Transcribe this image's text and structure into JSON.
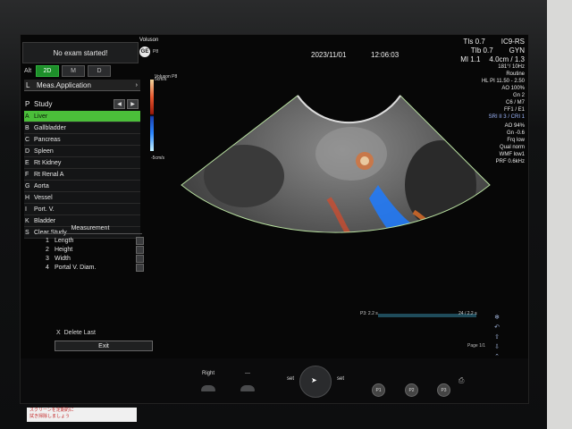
{
  "header": {
    "brand": "Voluson",
    "brand_sub": "P8",
    "date": "2023/11/01",
    "time": "12:06:03",
    "tis": "TIs  0.7",
    "tib": "TIb  0.7",
    "mi": "MI  1.1",
    "probe": "IC9-RS",
    "app": "GYN",
    "depth": "4.0cm / 1.3"
  },
  "left_panel": {
    "status": "No exam started!",
    "mode_label": "Alt",
    "modes": [
      "2D",
      "M",
      "D"
    ],
    "meas_key": "L",
    "meas_app": "Meas.Application",
    "study_key": "P",
    "study_label": "Study",
    "study_items": [
      {
        "key": "A",
        "label": "Liver"
      },
      {
        "key": "B",
        "label": "Gallbladder"
      },
      {
        "key": "C",
        "label": "Pancreas"
      },
      {
        "key": "D",
        "label": "Spleen"
      },
      {
        "key": "E",
        "label": "Rt Kidney"
      },
      {
        "key": "F",
        "label": "Rt Renal A"
      },
      {
        "key": "G",
        "label": "Aorta"
      },
      {
        "key": "H",
        "label": "Vessel"
      },
      {
        "key": "I",
        "label": "Port. V."
      },
      {
        "key": "K",
        "label": "Bladder"
      },
      {
        "key": "S",
        "label": "Clear Study"
      }
    ],
    "measurement_header": "Measurement",
    "measurements": [
      {
        "key": "1",
        "label": "Length"
      },
      {
        "key": "2",
        "label": "Height"
      },
      {
        "key": "3",
        "label": "Width"
      },
      {
        "key": "4",
        "label": "Portal V. Diam."
      }
    ],
    "delete_key": "X",
    "delete_label": "Delete Last",
    "exit_label": "Exit"
  },
  "image_params": {
    "frame": "181°/ 10Hz",
    "routine": "Routine",
    "hl": "HL PI 11.50 - 2.50",
    "ao": "AO 100%",
    "gn": "Gn  2",
    "c6": "C6 / M7",
    "ff": "FF1 / E1",
    "sri": "SRI II 3 / CRI 1"
  },
  "color_params": {
    "ao": "AO 94%",
    "gn": "Gn  -0.6",
    "frq": "Frq low",
    "qual": "Qual norm",
    "wmf": "WMF low1",
    "prf": "PRF  0.6kHz"
  },
  "scale": {
    "top": "5cm/s",
    "bottom": "-5cm/s",
    "cmps_sub": "Voluson P8"
  },
  "timeline": {
    "left": "P3:  2.2 s",
    "right": "24 / 2.2 s",
    "page": "Page 1/1"
  },
  "bottom": {
    "soft1": "Right",
    "soft2": "---",
    "set_left": "set",
    "set_right": "set",
    "p_buttons": [
      "P1",
      "P2",
      "P3"
    ]
  },
  "sticker": [
    "スクリーンを定期的に",
    "拭き掃除しましょう"
  ]
}
